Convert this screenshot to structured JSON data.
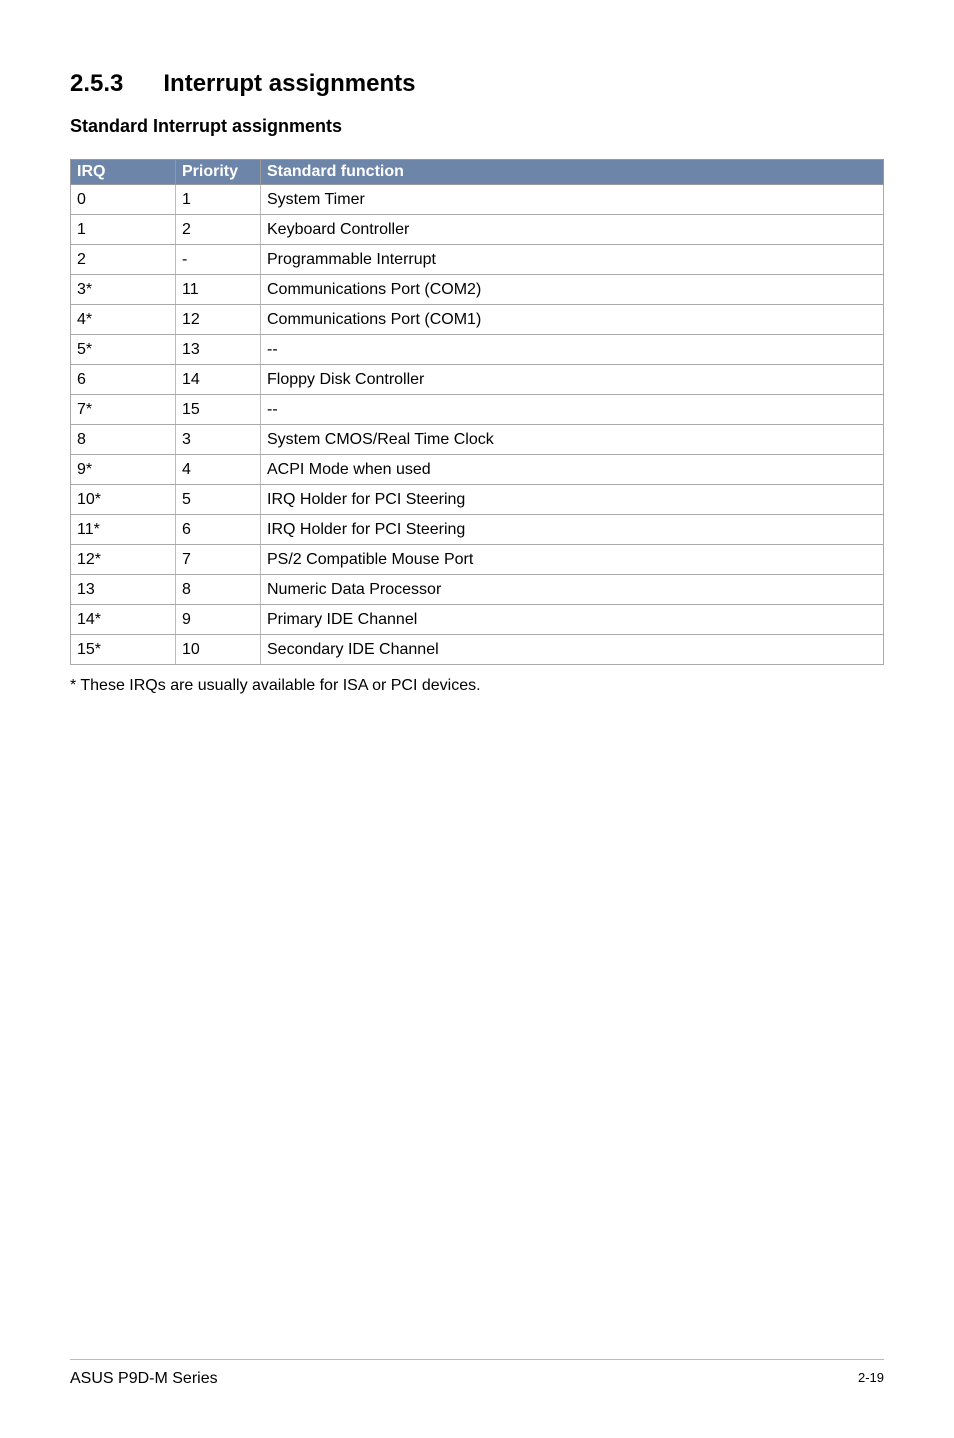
{
  "heading": {
    "number": "2.5.3",
    "title": "Interrupt assignments"
  },
  "subheading": "Standard Interrupt assignments",
  "table": {
    "headers": {
      "col1": "IRQ",
      "col2": "Priority",
      "col3": "Standard function"
    },
    "rows": [
      {
        "irq": "0",
        "priority": "1",
        "func": "System Timer"
      },
      {
        "irq": "1",
        "priority": "2",
        "func": "Keyboard Controller"
      },
      {
        "irq": "2",
        "priority": "-",
        "func": "Programmable Interrupt"
      },
      {
        "irq": "3*",
        "priority": "11",
        "func": "Communications Port (COM2)"
      },
      {
        "irq": "4*",
        "priority": "12",
        "func": "Communications Port (COM1)"
      },
      {
        "irq": "5*",
        "priority": "13",
        "func": "--"
      },
      {
        "irq": "6",
        "priority": "14",
        "func": "Floppy Disk Controller"
      },
      {
        "irq": "7*",
        "priority": "15",
        "func": "--"
      },
      {
        "irq": "8",
        "priority": "3",
        "func": "System CMOS/Real Time Clock"
      },
      {
        "irq": "9*",
        "priority": "4",
        "func": "ACPI Mode when used"
      },
      {
        "irq": "10*",
        "priority": "5",
        "func": "IRQ Holder for PCI Steering"
      },
      {
        "irq": "11*",
        "priority": "6",
        "func": "IRQ Holder for PCI Steering"
      },
      {
        "irq": "12*",
        "priority": "7",
        "func": "PS/2 Compatible Mouse Port"
      },
      {
        "irq": "13",
        "priority": "8",
        "func": "Numeric Data Processor"
      },
      {
        "irq": "14*",
        "priority": "9",
        "func": "Primary IDE Channel"
      },
      {
        "irq": "15*",
        "priority": "10",
        "func": "Secondary IDE Channel"
      }
    ]
  },
  "footnote": "* These IRQs are usually available for ISA or PCI devices.",
  "footer": {
    "left": "ASUS P9D-M Series",
    "right": "2-19"
  }
}
